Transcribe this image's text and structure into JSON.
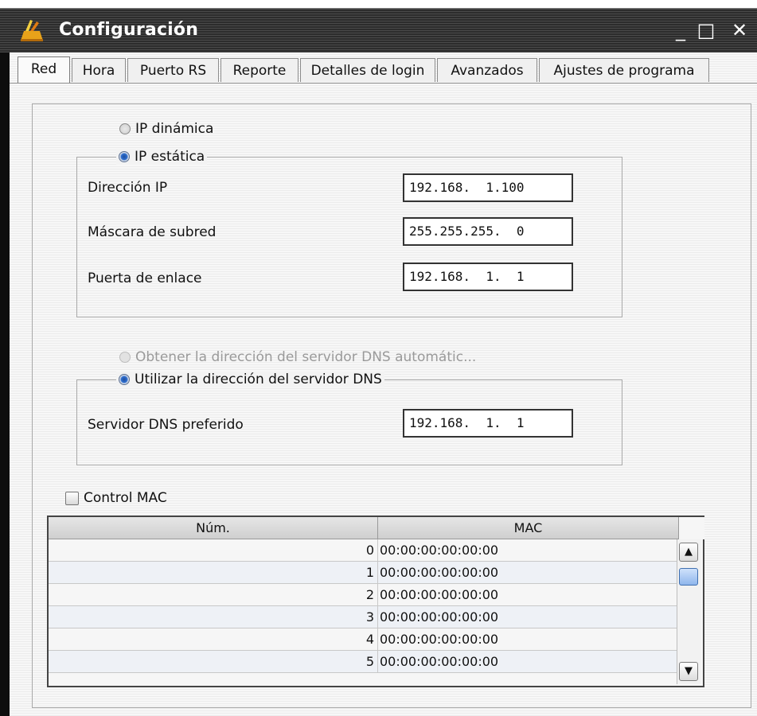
{
  "window": {
    "title": "Configuración",
    "minimize": "_",
    "maximize": "□",
    "close": "✕"
  },
  "tabs": [
    {
      "label": "Red",
      "active": true
    },
    {
      "label": "Hora"
    },
    {
      "label": "Puerto RS"
    },
    {
      "label": "Reporte"
    },
    {
      "label": "Detalles de login"
    },
    {
      "label": "Avanzados"
    },
    {
      "label": "Ajustes de programa"
    }
  ],
  "ip": {
    "dynamic_label": "IP dinámica",
    "static_label": "IP estática",
    "address_label": "Dirección IP",
    "address_value": "192.168.  1.100",
    "mask_label": "Máscara de subred",
    "mask_value": "255.255.255.  0",
    "gateway_label": "Puerta de enlace",
    "gateway_value": "192.168.  1.  1"
  },
  "dns": {
    "auto_label": "Obtener la dirección del servidor DNS automátic...",
    "manual_label": "Utilizar la dirección del servidor DNS",
    "preferred_label": "Servidor DNS preferido",
    "preferred_value": "192.168.  1.  1"
  },
  "mac_control": {
    "label": "Control MAC",
    "checked": false
  },
  "mac_table": {
    "headers": [
      "Núm.",
      "MAC"
    ],
    "rows": [
      {
        "num": "0",
        "mac": "00:00:00:00:00:00"
      },
      {
        "num": "1",
        "mac": "00:00:00:00:00:00"
      },
      {
        "num": "2",
        "mac": "00:00:00:00:00:00"
      },
      {
        "num": "3",
        "mac": "00:00:00:00:00:00"
      },
      {
        "num": "4",
        "mac": "00:00:00:00:00:00"
      },
      {
        "num": "5",
        "mac": "00:00:00:00:00:00"
      }
    ]
  },
  "scroll": {
    "up": "▲",
    "down": "▼"
  }
}
